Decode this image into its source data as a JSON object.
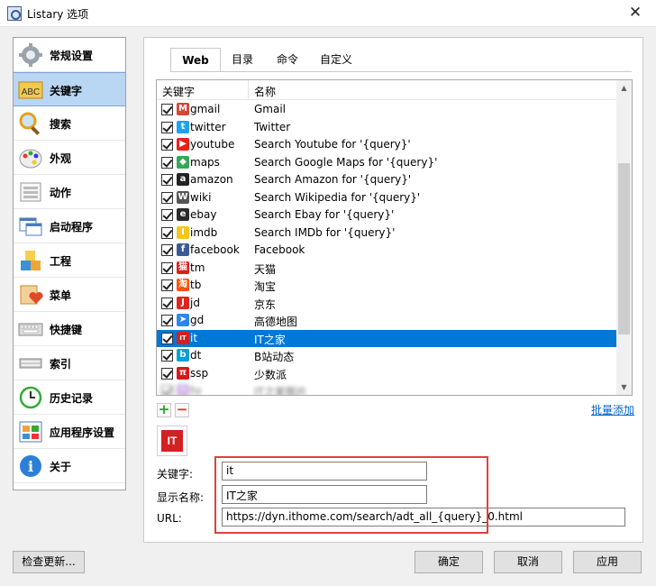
{
  "window": {
    "title": "Listary 选项",
    "close_glyph": "✕"
  },
  "sidebar": {
    "items": [
      {
        "label": "常规设置",
        "icon": "gear-icon"
      },
      {
        "label": "关键字",
        "icon": "abc-icon",
        "icon_text": "ABC"
      },
      {
        "label": "搜索",
        "icon": "magnifier-icon"
      },
      {
        "label": "外观",
        "icon": "palette-icon"
      },
      {
        "label": "动作",
        "icon": "actions-icon"
      },
      {
        "label": "启动程序",
        "icon": "windows-icon"
      },
      {
        "label": "工程",
        "icon": "blocks-icon"
      },
      {
        "label": "菜单",
        "icon": "menu-heart-icon"
      },
      {
        "label": "快捷键",
        "icon": "keyboard-icon"
      },
      {
        "label": "索引",
        "icon": "index-icon"
      },
      {
        "label": "历史记录",
        "icon": "clock-icon"
      },
      {
        "label": "应用程序设置",
        "icon": "app-settings-icon"
      },
      {
        "label": "关于",
        "icon": "info-icon",
        "icon_text": "i"
      }
    ],
    "active_index": 1
  },
  "tabs": [
    {
      "label": "Web",
      "active": true
    },
    {
      "label": "目录",
      "active": false
    },
    {
      "label": "命令",
      "active": false
    },
    {
      "label": "自定义",
      "active": false
    }
  ],
  "list": {
    "headers": {
      "keyword": "关键字",
      "name": "名称"
    },
    "rows": [
      {
        "keyword": "gmail",
        "name": "Gmail",
        "icon": "gmail-icon",
        "color": "#d44638",
        "glyph": "M"
      },
      {
        "keyword": "twitter",
        "name": "Twitter",
        "icon": "twitter-icon",
        "color": "#1da1f2",
        "glyph": "t"
      },
      {
        "keyword": "youtube",
        "name": "Search Youtube for '{query}'",
        "icon": "youtube-icon",
        "color": "#e62117",
        "glyph": "▶"
      },
      {
        "keyword": "maps",
        "name": "Search Google Maps for '{query}'",
        "icon": "maps-icon",
        "color": "#34a853",
        "glyph": "◆"
      },
      {
        "keyword": "amazon",
        "name": "Search Amazon for '{query}'",
        "icon": "amazon-icon",
        "color": "#222222",
        "glyph": "a"
      },
      {
        "keyword": "wiki",
        "name": "Search Wikipedia for '{query}'",
        "icon": "wikipedia-icon",
        "color": "#555555",
        "glyph": "W"
      },
      {
        "keyword": "ebay",
        "name": "Search Ebay for '{query}'",
        "icon": "ebay-icon",
        "color": "#2b2b2b",
        "glyph": "e"
      },
      {
        "keyword": "imdb",
        "name": "Search IMDb for '{query}'",
        "icon": "imdb-icon",
        "color": "#f5c518",
        "glyph": "I"
      },
      {
        "keyword": "facebook",
        "name": "Facebook",
        "icon": "facebook-icon",
        "color": "#3b5998",
        "glyph": "f"
      },
      {
        "keyword": "tm",
        "name": "天猫",
        "icon": "tmall-icon",
        "color": "#e21b1b",
        "glyph": "猫"
      },
      {
        "keyword": "tb",
        "name": "淘宝",
        "icon": "taobao-icon",
        "color": "#ff5000",
        "glyph": "淘"
      },
      {
        "keyword": "jd",
        "name": "京东",
        "icon": "jd-icon",
        "color": "#e1251b",
        "glyph": "J"
      },
      {
        "keyword": "gd",
        "name": "高德地图",
        "icon": "amap-icon",
        "color": "#2b86f0",
        "glyph": "➤"
      },
      {
        "keyword": "it",
        "name": "IT之家",
        "icon": "ithome-icon",
        "color": "#d32020",
        "glyph": "IT",
        "selected": true
      },
      {
        "keyword": "dt",
        "name": "B站动态",
        "icon": "bilibili-icon",
        "color": "#00a1d6",
        "glyph": "b"
      },
      {
        "keyword": "ssp",
        "name": "少数派",
        "icon": "sspai-icon",
        "color": "#d7191a",
        "glyph": "π"
      },
      {
        "keyword": "tu",
        "name": "IT之家图片",
        "icon": "blurred-icon",
        "color": "#b48ad8",
        "glyph": "•",
        "faded": true
      }
    ]
  },
  "actions": {
    "add": "+",
    "remove": "−",
    "batch_add": "批量添加"
  },
  "detail": {
    "preview_text": "IT",
    "keyword_label": "关键字:",
    "keyword_value": "it",
    "name_label": "显示名称:",
    "name_value": "IT之家",
    "url_label": "URL:",
    "url_value": "https://dyn.ithome.com/search/adt_all_{query}_0.html"
  },
  "buttons": {
    "check_update": "检查更新...",
    "ok": "确定",
    "cancel": "取消",
    "apply": "应用"
  },
  "colors": {
    "selection": "#0078d7",
    "sidebar_active": "#b9d6f3",
    "highlight_box": "#e04040",
    "link": "#0066cc"
  }
}
